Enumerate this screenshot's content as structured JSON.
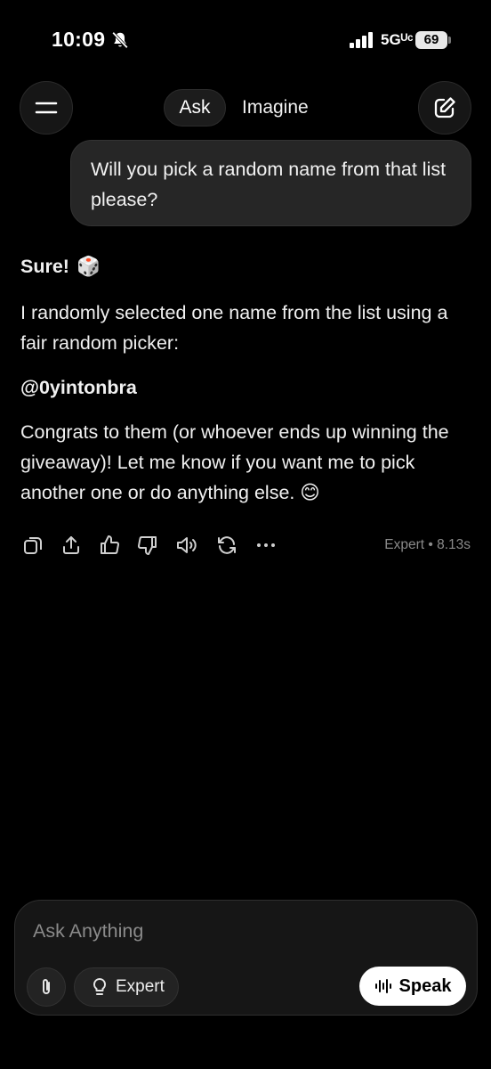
{
  "status_bar": {
    "time": "10:09",
    "network": "5Gᵁᶜ",
    "battery": "69",
    "icons": [
      "bell-slash-icon",
      "signal-bars-icon",
      "battery-icon"
    ]
  },
  "nav": {
    "menu_icon": "hamburger-icon",
    "tabs": [
      {
        "label": "Ask",
        "active": true
      },
      {
        "label": "Imagine",
        "active": false
      }
    ],
    "new_chat_icon": "edit-icon"
  },
  "conversation": {
    "user_message": "Will you pick a random name from that list please?",
    "assistant": {
      "greeting": "Sure!",
      "greeting_emoji": "🎲",
      "paragraph_1": "I randomly selected one name from the list using a fair random picker:",
      "handle": "@0yintonbra",
      "paragraph_2": "Congrats to them (or whoever ends up winning the giveaway)! Let me know if you want me to pick another one or do anything else.",
      "paragraph_2_emoji": "😊"
    },
    "actions": [
      "copy-icon",
      "share-icon",
      "thumbs-up-icon",
      "thumbs-down-icon",
      "speaker-icon",
      "regenerate-icon",
      "more-icon"
    ],
    "meta": "Expert • 8.13s"
  },
  "composer": {
    "placeholder": "Ask Anything",
    "value": "",
    "attach_icon": "paperclip-icon",
    "mode_label": "Expert",
    "mode_icon": "lightbulb-icon",
    "speak_label": "Speak",
    "speak_icon": "waveform-icon"
  },
  "colors": {
    "background": "#000000",
    "bubble": "#262626",
    "text": "#f0f0f0",
    "muted": "#8a8a8a",
    "speak_button": "#ffffff"
  }
}
